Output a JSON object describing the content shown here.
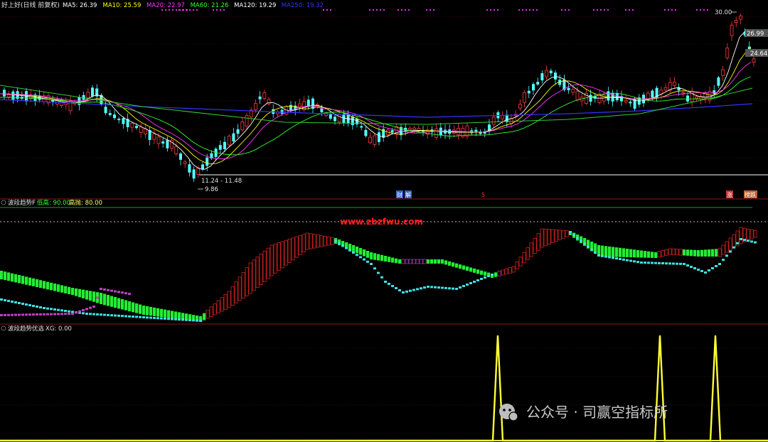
{
  "main_panel": {
    "title": "好上好(日线 前复权)",
    "ma_legend": [
      {
        "label": "MA5: 26.39",
        "color": "#ffffff"
      },
      {
        "label": "MA10: 25.59",
        "color": "#ffff00"
      },
      {
        "label": "MA20: 22.97",
        "color": "#ff33ff"
      },
      {
        "label": "MA60: 21.26",
        "color": "#33ff33"
      },
      {
        "label": "MA120: 19.29",
        "color": "#ffffff"
      },
      {
        "label": "MA250: 19.32",
        "color": "#3333ff"
      }
    ],
    "price_labels": {
      "high": "30.00",
      "p1": "26.99",
      "p2": "24.64"
    },
    "low_range_label": "11.24 - 11.48",
    "low_label": "9.86",
    "event_tags": [
      {
        "text": "财",
        "bg": "#3060c0"
      },
      {
        "text": "解",
        "bg": "#3060c0"
      },
      {
        "text": "涨",
        "bg": "#c03030"
      },
      {
        "text": "榜跌",
        "bg": "#c06030"
      }
    ],
    "mark_glyph": "5"
  },
  "indicator_panel": {
    "title": "波段趋势F",
    "legend": [
      {
        "label": "低高: 90.00",
        "color": "#33ff33"
      },
      {
        "label": "高抛: 80.00",
        "color": "#ffff66"
      }
    ],
    "watermark": "www.zbzfwu.com"
  },
  "signal_panel": {
    "title": "波段趋势优选",
    "legend": "XG: 0.00"
  },
  "footer_watermark": "公众号 · 司赢空指标所",
  "chart_data": [
    {
      "type": "candlestick",
      "title": "好上好(日线 前复权)",
      "y_labels": [
        "30.00",
        "26.99",
        "24.64",
        "11.24 - 11.48",
        "9.86"
      ],
      "series": [
        {
          "name": "MA5",
          "value": 26.39
        },
        {
          "name": "MA10",
          "value": 25.59
        },
        {
          "name": "MA20",
          "value": 22.97
        },
        {
          "name": "MA60",
          "value": 21.26
        },
        {
          "name": "MA120",
          "value": 19.29
        },
        {
          "name": "MA250",
          "value": 19.32
        }
      ]
    },
    {
      "type": "bar",
      "title": "波段趋势F",
      "series": [
        {
          "name": "低高",
          "value": 90.0
        },
        {
          "name": "高抛",
          "value": 80.0
        }
      ]
    },
    {
      "type": "line",
      "title": "波段趋势优选",
      "series": [
        {
          "name": "XG",
          "value": 0.0
        }
      ]
    }
  ]
}
